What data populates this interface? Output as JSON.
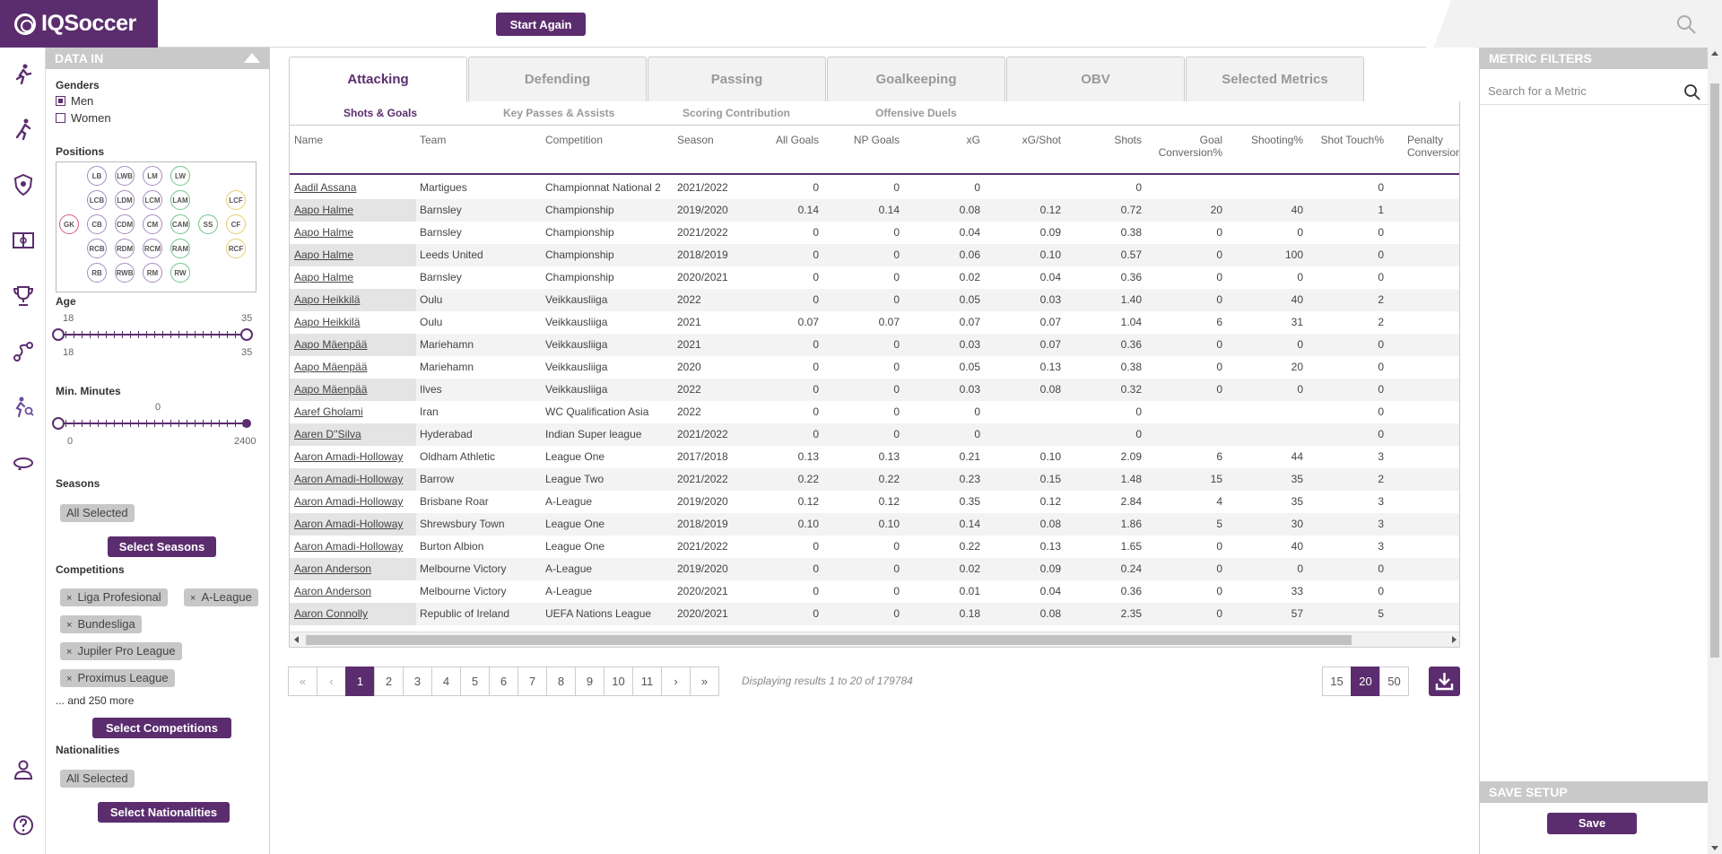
{
  "app": {
    "logo_text": "IQSoccer",
    "start_again": "Start Again"
  },
  "data_in": {
    "title": "DATA IN",
    "genders_label": "Genders",
    "genders": [
      {
        "label": "Men",
        "checked": true
      },
      {
        "label": "Women",
        "checked": false
      }
    ],
    "positions_label": "Positions",
    "positions": [
      "LB",
      "LWB",
      "LM",
      "LW",
      "LCB",
      "LDM",
      "LCM",
      "LAM",
      "GK",
      "CB",
      "CDM",
      "CM",
      "CAM",
      "SS",
      "CF",
      "LCF",
      "RCF",
      "RCB",
      "RDM",
      "RCM",
      "RAM",
      "RB",
      "RWB",
      "RM",
      "RW"
    ],
    "age_label": "Age",
    "age_min": "18",
    "age_max": "35",
    "age_min_sel": "18",
    "age_max_sel": "35",
    "min_minutes_label": "Min. Minutes",
    "min_minutes_value": "0",
    "min_minutes_lo": "0",
    "min_minutes_hi": "2400",
    "seasons_label": "Seasons",
    "seasons_chip": "All Selected",
    "select_seasons": "Select Seasons",
    "competitions_label": "Competitions",
    "competition_chips": [
      "Liga Profesional",
      "A-League",
      "Bundesliga",
      "Jupiler Pro League",
      "Proximus League"
    ],
    "competitions_more": "... and 250 more",
    "select_competitions": "Select Competitions",
    "nationalities_label": "Nationalities",
    "nationalities_chip": "All Selected",
    "select_nationalities": "Select Nationalities"
  },
  "tabs": [
    "Attacking",
    "Defending",
    "Passing",
    "Goalkeeping",
    "OBV",
    "Selected Metrics"
  ],
  "subtabs": [
    "Shots & Goals",
    "Key Passes & Assists",
    "Scoring Contribution",
    "Offensive Duels"
  ],
  "columns": [
    "Name",
    "Team",
    "Competition",
    "Season",
    "All Goals",
    "NP Goals",
    "xG",
    "xG/Shot",
    "Shots",
    "Goal Conversion%",
    "Shooting%",
    "Shot Touch%",
    "Penalty Conversion%"
  ],
  "rows": [
    [
      "Aadil Assana",
      "Martigues",
      "Championnat National 2",
      "2021/2022",
      "0",
      "0",
      "0",
      "",
      "0",
      "",
      "",
      "0"
    ],
    [
      "Aapo Halme",
      "Barnsley",
      "Championship",
      "2019/2020",
      "0.14",
      "0.14",
      "0.08",
      "0.12",
      "0.72",
      "20",
      "40",
      "1"
    ],
    [
      "Aapo Halme",
      "Barnsley",
      "Championship",
      "2021/2022",
      "0",
      "0",
      "0.04",
      "0.09",
      "0.38",
      "0",
      "0",
      "0"
    ],
    [
      "Aapo Halme",
      "Leeds United",
      "Championship",
      "2018/2019",
      "0",
      "0",
      "0.06",
      "0.10",
      "0.57",
      "0",
      "100",
      "0"
    ],
    [
      "Aapo Halme",
      "Barnsley",
      "Championship",
      "2020/2021",
      "0",
      "0",
      "0.02",
      "0.04",
      "0.36",
      "0",
      "0",
      "0"
    ],
    [
      "Aapo Heikkilä",
      "Oulu",
      "Veikkausliiga",
      "2022",
      "0",
      "0",
      "0.05",
      "0.03",
      "1.40",
      "0",
      "40",
      "2"
    ],
    [
      "Aapo Heikkilä",
      "Oulu",
      "Veikkausliiga",
      "2021",
      "0.07",
      "0.07",
      "0.07",
      "0.07",
      "1.04",
      "6",
      "31",
      "2"
    ],
    [
      "Aapo Mäenpää",
      "Mariehamn",
      "Veikkausliiga",
      "2021",
      "0",
      "0",
      "0.03",
      "0.07",
      "0.36",
      "0",
      "0",
      "0"
    ],
    [
      "Aapo Mäenpää",
      "Mariehamn",
      "Veikkausliiga",
      "2020",
      "0",
      "0",
      "0.05",
      "0.13",
      "0.38",
      "0",
      "20",
      "0"
    ],
    [
      "Aapo Mäenpää",
      "Ilves",
      "Veikkausliiga",
      "2022",
      "0",
      "0",
      "0.03",
      "0.08",
      "0.32",
      "0",
      "0",
      "0"
    ],
    [
      "Aaref Gholami",
      "Iran",
      "WC Qualification Asia",
      "2022",
      "0",
      "0",
      "0",
      "",
      "0",
      "",
      "",
      "0"
    ],
    [
      "Aaren D''Silva",
      "Hyderabad",
      "Indian Super league",
      "2021/2022",
      "0",
      "0",
      "0",
      "",
      "0",
      "",
      "",
      "0"
    ],
    [
      "Aaron Amadi-Holloway",
      "Oldham Athletic",
      "League One",
      "2017/2018",
      "0.13",
      "0.13",
      "0.21",
      "0.10",
      "2.09",
      "6",
      "44",
      "3"
    ],
    [
      "Aaron Amadi-Holloway",
      "Barrow",
      "League Two",
      "2021/2022",
      "0.22",
      "0.22",
      "0.23",
      "0.15",
      "1.48",
      "15",
      "35",
      "2"
    ],
    [
      "Aaron Amadi-Holloway",
      "Brisbane Roar",
      "A-League",
      "2019/2020",
      "0.12",
      "0.12",
      "0.35",
      "0.12",
      "2.84",
      "4",
      "35",
      "3"
    ],
    [
      "Aaron Amadi-Holloway",
      "Shrewsbury Town",
      "League One",
      "2018/2019",
      "0.10",
      "0.10",
      "0.14",
      "0.08",
      "1.86",
      "5",
      "30",
      "3"
    ],
    [
      "Aaron Amadi-Holloway",
      "Burton Albion",
      "League One",
      "2021/2022",
      "0",
      "0",
      "0.22",
      "0.13",
      "1.65",
      "0",
      "40",
      "3"
    ],
    [
      "Aaron Anderson",
      "Melbourne Victory",
      "A-League",
      "2019/2020",
      "0",
      "0",
      "0.02",
      "0.09",
      "0.24",
      "0",
      "0",
      "0"
    ],
    [
      "Aaron Anderson",
      "Melbourne Victory",
      "A-League",
      "2020/2021",
      "0",
      "0",
      "0.01",
      "0.04",
      "0.36",
      "0",
      "33",
      "0"
    ],
    [
      "Aaron Connolly",
      "Republic of Ireland",
      "UEFA Nations League",
      "2020/2021",
      "0",
      "0",
      "0.18",
      "0.08",
      "2.35",
      "0",
      "57",
      "5"
    ]
  ],
  "pagination": {
    "first": "«",
    "prev": "‹",
    "pages": [
      "1",
      "2",
      "3",
      "4",
      "5",
      "6",
      "7",
      "8",
      "9",
      "10",
      "11"
    ],
    "current": "1",
    "next": "›",
    "last": "»",
    "display_text": "Displaying results 1 to 20 of 179784",
    "page_sizes": [
      "15",
      "20",
      "50"
    ],
    "page_size_selected": "20"
  },
  "metric_filters": {
    "title": "METRIC FILTERS",
    "search_placeholder": "Search for a Metric"
  },
  "save_setup": {
    "title": "SAVE SETUP",
    "save_label": "Save"
  },
  "colors": {
    "brand": "#5b2d6e",
    "header_grey": "#c9c9c9"
  },
  "icons": [
    "running-icon",
    "sprint-icon",
    "shield-icon",
    "pitch-icon",
    "trophy-icon",
    "dribble-icon",
    "player-search-icon",
    "rotate-icon",
    "user-icon",
    "help-icon",
    "search-icon",
    "download-icon"
  ]
}
